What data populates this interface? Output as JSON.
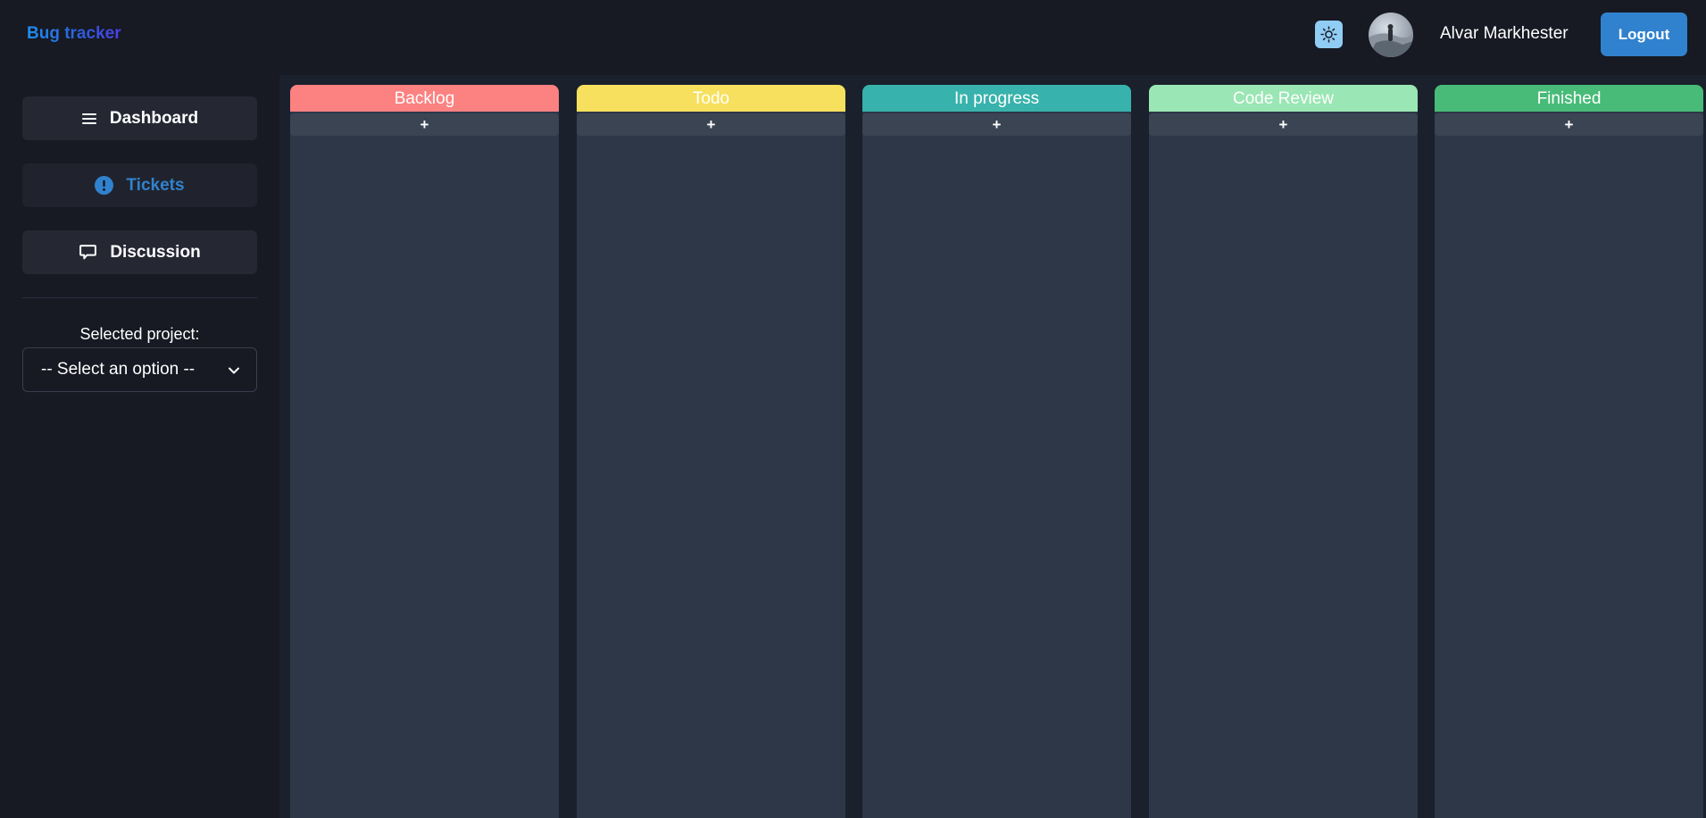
{
  "app": {
    "logo": "Bug tracker",
    "user_name": "Alvar Markhester",
    "logout_label": "Logout",
    "theme_icon": "sun-icon"
  },
  "sidebar": {
    "items": [
      {
        "label": "Dashboard",
        "icon": "hamburger-icon",
        "active": false
      },
      {
        "label": "Tickets",
        "icon": "alert-circle-icon",
        "active": true
      },
      {
        "label": "Discussion",
        "icon": "chat-bubble-icon",
        "active": false
      }
    ],
    "project_label": "Selected project:",
    "project_select_value": "-- Select an option --"
  },
  "board": {
    "add_label": "+",
    "columns": [
      {
        "title": "Backlog",
        "color": "#fc8181"
      },
      {
        "title": "Todo",
        "color": "#f6e05e"
      },
      {
        "title": "In progress",
        "color": "#38b2ac"
      },
      {
        "title": "Code Review",
        "color": "#9ae6b4"
      },
      {
        "title": "Finished",
        "color": "#48bb78"
      }
    ]
  },
  "colors": {
    "background": "#171923",
    "board_background": "#1a202c",
    "column_body": "#2d3748",
    "accent": "#3182ce",
    "theme_toggle": "#90cdf4"
  }
}
